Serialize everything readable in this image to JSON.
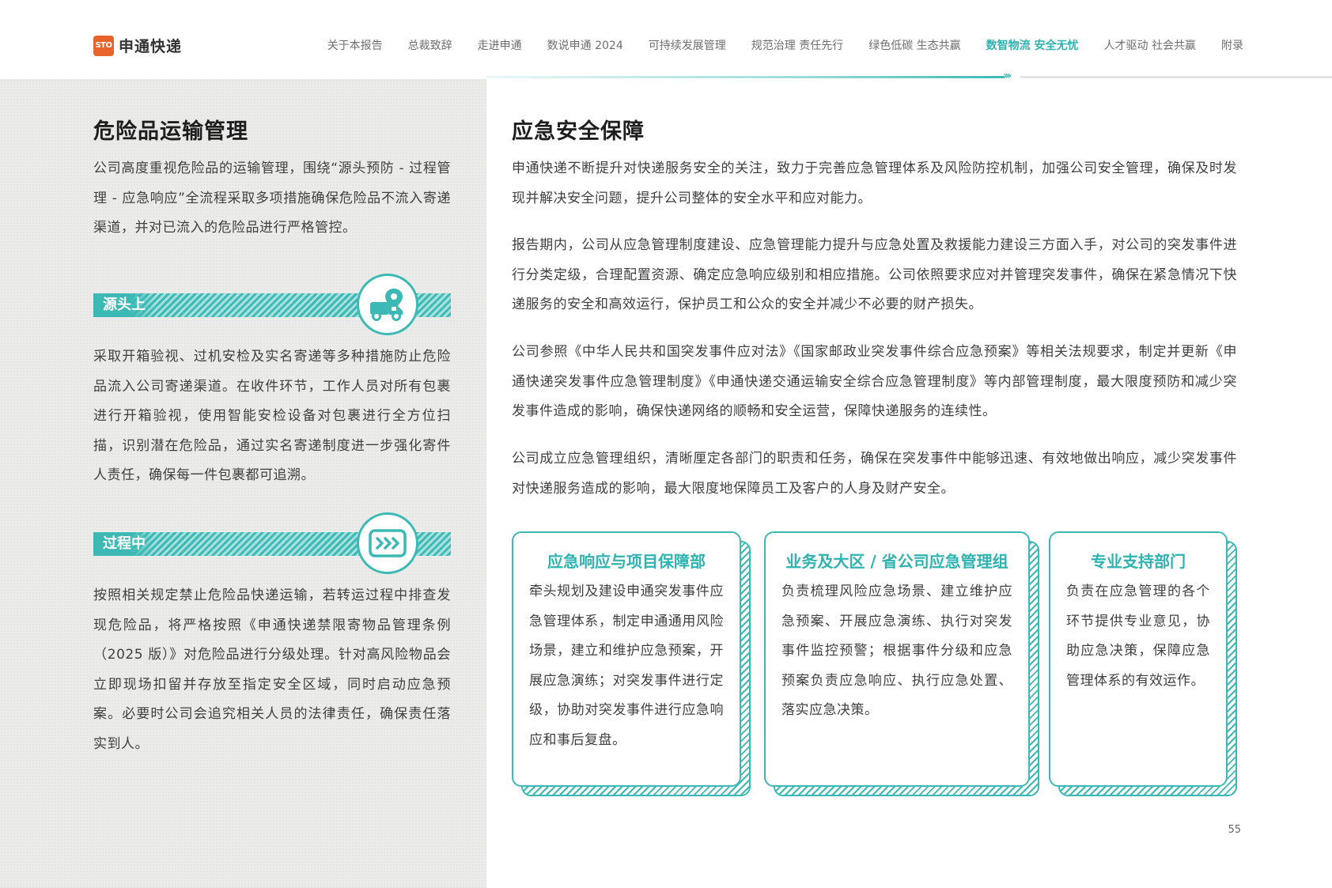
{
  "header": {
    "logo_mark": "STO",
    "logo_text": "申通快递",
    "nav": [
      "关于本报告",
      "总裁致辞",
      "走进申通",
      "数说申通 2024",
      "可持续发展管理",
      "规范治理 责任先行",
      "绿色低碳 生态共赢",
      "数智物流 安全无忧",
      "人才驱动 社会共赢",
      "附录"
    ],
    "active_nav_index": 7
  },
  "left": {
    "title": "危险品运输管理",
    "intro": "公司高度重视危险品的运输管理，围绕“源头预防 - 过程管理 - 应急响应”全流程采取多项措施确保危险品不流入寄递渠道，并对已流入的危险品进行严格管控。",
    "section1": {
      "tag": "源头上",
      "icon": "truck-location-icon",
      "text": "采取开箱验视、过机安检及实名寄递等多种措施防止危险品流入公司寄递渠道。在收件环节，工作人员对所有包裹进行开箱验视，使用智能安检设备对包裹进行全方位扫描，识别潜在危险品，通过实名寄递制度进一步强化寄件人责任，确保每一件包裹都可追溯。"
    },
    "section2": {
      "tag": "过程中",
      "icon": "process-flow-icon",
      "text": "按照相关规定禁止危险品快递运输，若转运过程中排查发现危险品，将严格按照《申通快递禁限寄物品管理条例（2025 版）》对危险品进行分级处理。针对高风险物品会立即现场扣留并存放至指定安全区域，同时启动应急预案。必要时公司会追究相关人员的法律责任，确保责任落实到人。"
    }
  },
  "right": {
    "title": "应急安全保障",
    "paragraphs": [
      "申通快递不断提升对快递服务安全的关注，致力于完善应急管理体系及风险防控机制，加强公司安全管理，确保及时发现并解决安全问题，提升公司整体的安全水平和应对能力。",
      "报告期内，公司从应急管理制度建设、应急管理能力提升与应急处置及救援能力建设三方面入手，对公司的突发事件进行分类定级，合理配置资源、确定应急响应级别和相应措施。公司依照要求应对并管理突发事件，确保在紧急情况下快递服务的安全和高效运行，保护员工和公众的安全并减少不必要的财产损失。",
      "公司参照《中华人民共和国突发事件应对法》《国家邮政业突发事件综合应急预案》等相关法规要求，制定并更新《申通快递突发事件应急管理制度》《申通快递交通运输安全综合应急管理制度》等内部管理制度，最大限度预防和减少突发事件造成的影响，确保快递网络的顺畅和安全运营，保障快递服务的连续性。",
      "公司成立应急管理组织，清晰厘定各部门的职责和任务，确保在突发事件中能够迅速、有效地做出响应，减少突发事件对快递服务造成的影响，最大限度地保障员工及客户的人身及财产安全。"
    ],
    "cards": [
      {
        "title": "应急响应与项目保障部",
        "body": "牵头规划及建设申通突发事件应急管理体系，制定申通通用风险场景，建立和维护应急预案，开展应急演练；对突发事件进行定级，协助对突发事件进行应急响应和事后复盘。"
      },
      {
        "title": "业务及大区 / 省公司应急管理组",
        "body": "负责梳理风险应急场景、建立维护应急预案、开展应急演练、执行对突发事件监控预警；根据事件分级和应急预案负责应急响应、执行应急处置、落实应急决策。"
      },
      {
        "title": "专业支持部门",
        "body": "负责在应急管理的各个环节提供专业意见，协助应急决策，保障应急管理体系的有效运作。"
      }
    ]
  },
  "page_number": "55",
  "colors": {
    "accent": "#3db9b5",
    "accent_text": "#2fb3b0",
    "logo": "#e8632b",
    "left_bg": "#ebebea"
  }
}
